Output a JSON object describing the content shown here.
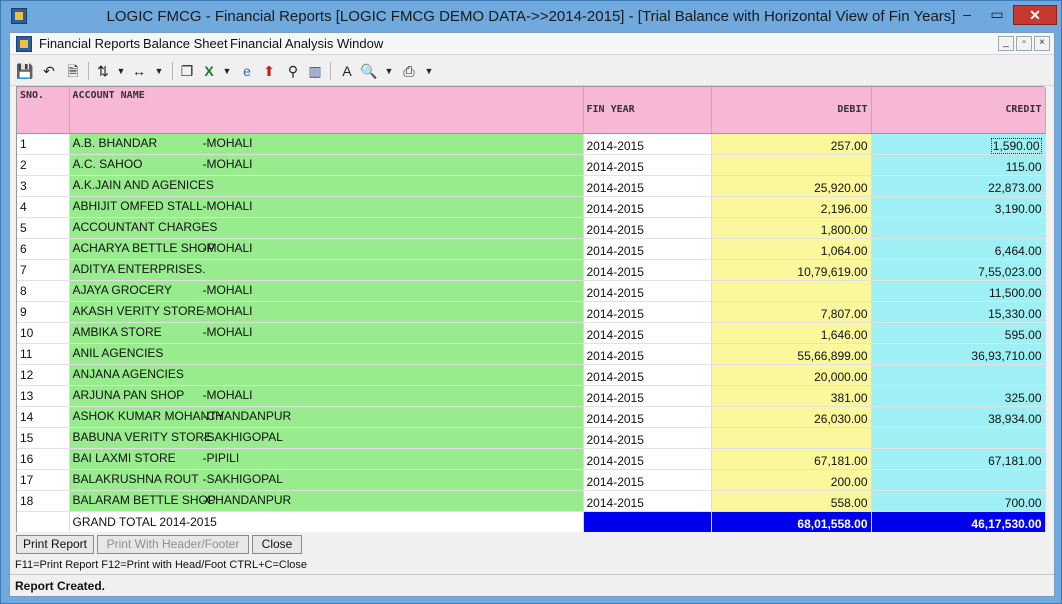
{
  "window": {
    "title": "LOGIC FMCG - Financial Reports  [LOGIC FMCG DEMO DATA->>2014-2015] - [Trial Balance with Horizontal View of Fin Years]",
    "min": "–",
    "max": "▭",
    "close": "✕"
  },
  "menu": [
    "Financial Reports",
    "Balance Sheet",
    "Financial Analysis",
    "Window"
  ],
  "mdi_controls": [
    "_",
    "▫",
    "×"
  ],
  "toolbar_icons": [
    "save-icon",
    "undo-icon",
    "export-icon",
    "sort-icon",
    "column-width-icon",
    "copy-icon",
    "excel-icon",
    "browser-icon",
    "up-arrow-icon",
    "find-icon",
    "chart-icon",
    "font-icon",
    "preview-icon",
    "print-icon"
  ],
  "table": {
    "headers": {
      "sno": "SNO.",
      "account": "ACCOUNT NAME",
      "fy": "FIN YEAR",
      "debit": "DEBIT",
      "credit": "CREDIT"
    },
    "rows": [
      {
        "sno": "1",
        "name": "A.B. BHANDAR",
        "loc": "-MOHALI",
        "fy": "2014-2015",
        "debit": "257.00",
        "credit": "1,590.00"
      },
      {
        "sno": "2",
        "name": "A.C. SAHOO",
        "loc": "-MOHALI",
        "fy": "2014-2015",
        "debit": "",
        "credit": "115.00"
      },
      {
        "sno": "3",
        "name": "A.K.JAIN AND AGENICES",
        "loc": "",
        "fy": "2014-2015",
        "debit": "25,920.00",
        "credit": "22,873.00"
      },
      {
        "sno": "4",
        "name": "ABHIJIT OMFED STALL",
        "loc": "-MOHALI",
        "fy": "2014-2015",
        "debit": "2,196.00",
        "credit": "3,190.00"
      },
      {
        "sno": "5",
        "name": "ACCOUNTANT CHARGES",
        "loc": "",
        "fy": "2014-2015",
        "debit": "1,800.00",
        "credit": ""
      },
      {
        "sno": "6",
        "name": "ACHARYA BETTLE SHOP",
        "loc": "-MOHALI",
        "fy": "2014-2015",
        "debit": "1,064.00",
        "credit": "6,464.00"
      },
      {
        "sno": "7",
        "name": "ADITYA ENTERPRISES.",
        "loc": "",
        "fy": "2014-2015",
        "debit": "10,79,619.00",
        "credit": "7,55,023.00"
      },
      {
        "sno": "8",
        "name": "AJAYA GROCERY",
        "loc": "-MOHALI",
        "fy": "2014-2015",
        "debit": "",
        "credit": "11,500.00"
      },
      {
        "sno": "9",
        "name": "AKASH VERITY STORE",
        "loc": "-MOHALI",
        "fy": "2014-2015",
        "debit": "7,807.00",
        "credit": "15,330.00"
      },
      {
        "sno": "10",
        "name": "AMBIKA STORE",
        "loc": "-MOHALI",
        "fy": "2014-2015",
        "debit": "1,646.00",
        "credit": "595.00"
      },
      {
        "sno": "11",
        "name": "ANIL AGENCIES",
        "loc": "",
        "fy": "2014-2015",
        "debit": "55,66,899.00",
        "credit": "36,93,710.00"
      },
      {
        "sno": "12",
        "name": "ANJANA AGENCIES",
        "loc": "",
        "fy": "2014-2015",
        "debit": "20,000.00",
        "credit": ""
      },
      {
        "sno": "13",
        "name": "ARJUNA PAN SHOP",
        "loc": "-MOHALI",
        "fy": "2014-2015",
        "debit": "381.00",
        "credit": "325.00"
      },
      {
        "sno": "14",
        "name": "ASHOK KUMAR MOHANTY",
        "loc": "-CHANDANPUR",
        "fy": "2014-2015",
        "debit": "26,030.00",
        "credit": "38,934.00"
      },
      {
        "sno": "15",
        "name": "BABUNA VERITY STORE",
        "loc": "-SAKHIGOPAL",
        "fy": "2014-2015",
        "debit": "",
        "credit": ""
      },
      {
        "sno": "16",
        "name": "BAI LAXMI STORE",
        "loc": "-PIPILI",
        "fy": "2014-2015",
        "debit": "67,181.00",
        "credit": "67,181.00"
      },
      {
        "sno": "17",
        "name": "BALAKRUSHNA ROUT",
        "loc": "-SAKHIGOPAL",
        "fy": "2014-2015",
        "debit": "200.00",
        "credit": ""
      },
      {
        "sno": "18",
        "name": "BALARAM BETTLE SHOP",
        "loc": "-CHANDANPUR",
        "fy": "2014-2015",
        "debit": "558.00",
        "credit": "700.00"
      }
    ],
    "total": {
      "label": "GRAND TOTAL 2014-2015",
      "debit": "68,01,558.00",
      "credit": "46,17,530.00"
    }
  },
  "buttons": {
    "print": "Print Report",
    "print_hf": "Print With Header/Footer",
    "close": "Close"
  },
  "hint": "F11=Print Report  F12=Print with Head/Foot  CTRL+C=Close",
  "status": "Report Created."
}
